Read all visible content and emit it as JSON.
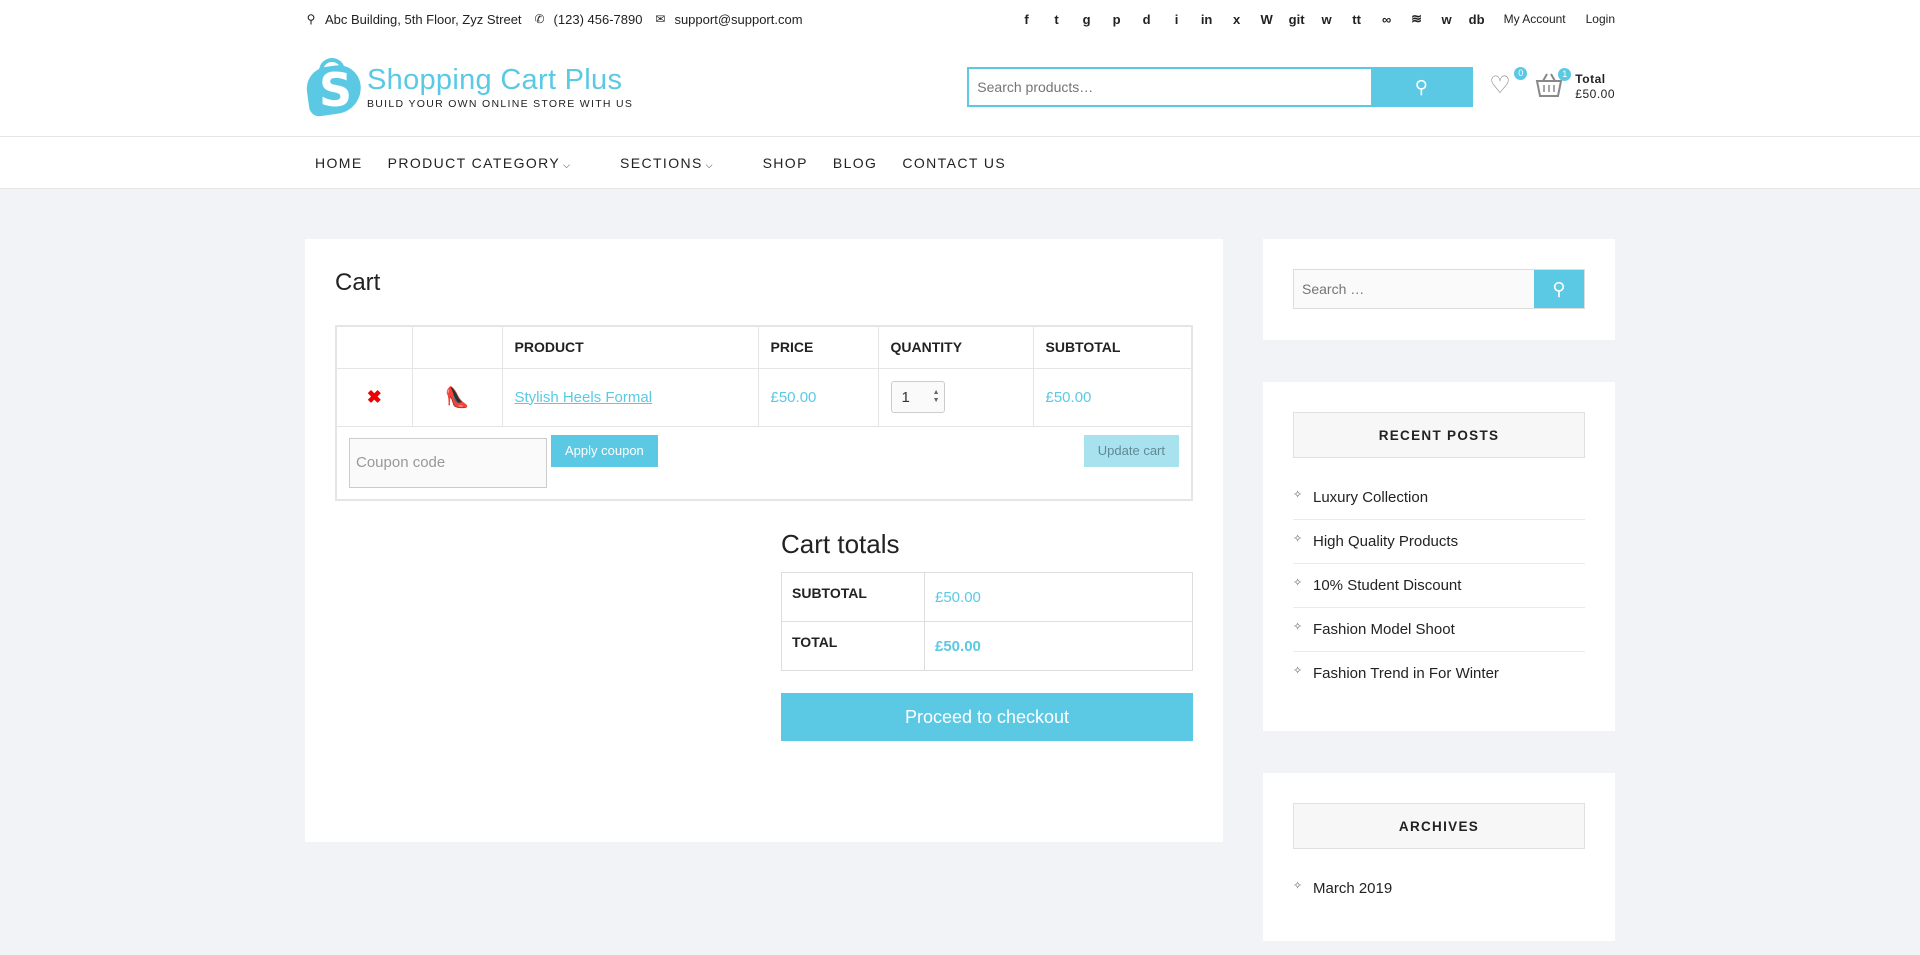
{
  "topbar": {
    "address": "Abc Building, 5th Floor, Zyz Street",
    "phone": "(123) 456-7890",
    "email": "support@support.com",
    "social_icons": [
      "f",
      "t",
      "g",
      "p",
      "d",
      "i",
      "in",
      "x",
      "W",
      "git",
      "w",
      "tt",
      "∞",
      "≋",
      "w",
      "db"
    ],
    "my_account": "My Account",
    "login": "Login"
  },
  "header": {
    "logo_name": "Shopping Cart Plus",
    "logo_tagline": "BUILD YOUR OWN ONLINE STORE WITH US",
    "search_placeholder": "Search products…",
    "wishlist_count": "0",
    "cart_count": "1",
    "cart_total_label": "Total",
    "cart_total_value": "£50.00"
  },
  "nav": {
    "home": "HOME",
    "product_category": "PRODUCT CATEGORY",
    "sections": "SECTIONS",
    "shop": "SHOP",
    "blog": "BLOG",
    "contact": "CONTACT US"
  },
  "cart": {
    "title": "Cart",
    "headers": {
      "product": "PRODUCT",
      "price": "PRICE",
      "quantity": "QUANTITY",
      "subtotal": "SUBTOTAL"
    },
    "item": {
      "name": "Stylish Heels Formal",
      "price": "£50.00",
      "quantity": "1",
      "subtotal": "£50.00"
    },
    "coupon_placeholder": "Coupon code",
    "apply_coupon": "Apply coupon",
    "update_cart": "Update cart"
  },
  "totals": {
    "title": "Cart totals",
    "subtotal_label": "SUBTOTAL",
    "subtotal_value": "£50.00",
    "total_label": "TOTAL",
    "total_value": "£50.00",
    "checkout": "Proceed to checkout"
  },
  "sidebar": {
    "search_placeholder": "Search …",
    "recent_title": "RECENT POSTS",
    "recent_posts": [
      "Luxury Collection",
      "High Quality Products",
      "10% Student Discount",
      "Fashion Model Shoot",
      "Fashion Trend in For Winter"
    ],
    "archives_title": "ARCHIVES",
    "archives": [
      "March 2019"
    ]
  },
  "colors": {
    "accent": "#5bc9e4",
    "remove": "#e00000",
    "bg": "#f1f3f6"
  }
}
